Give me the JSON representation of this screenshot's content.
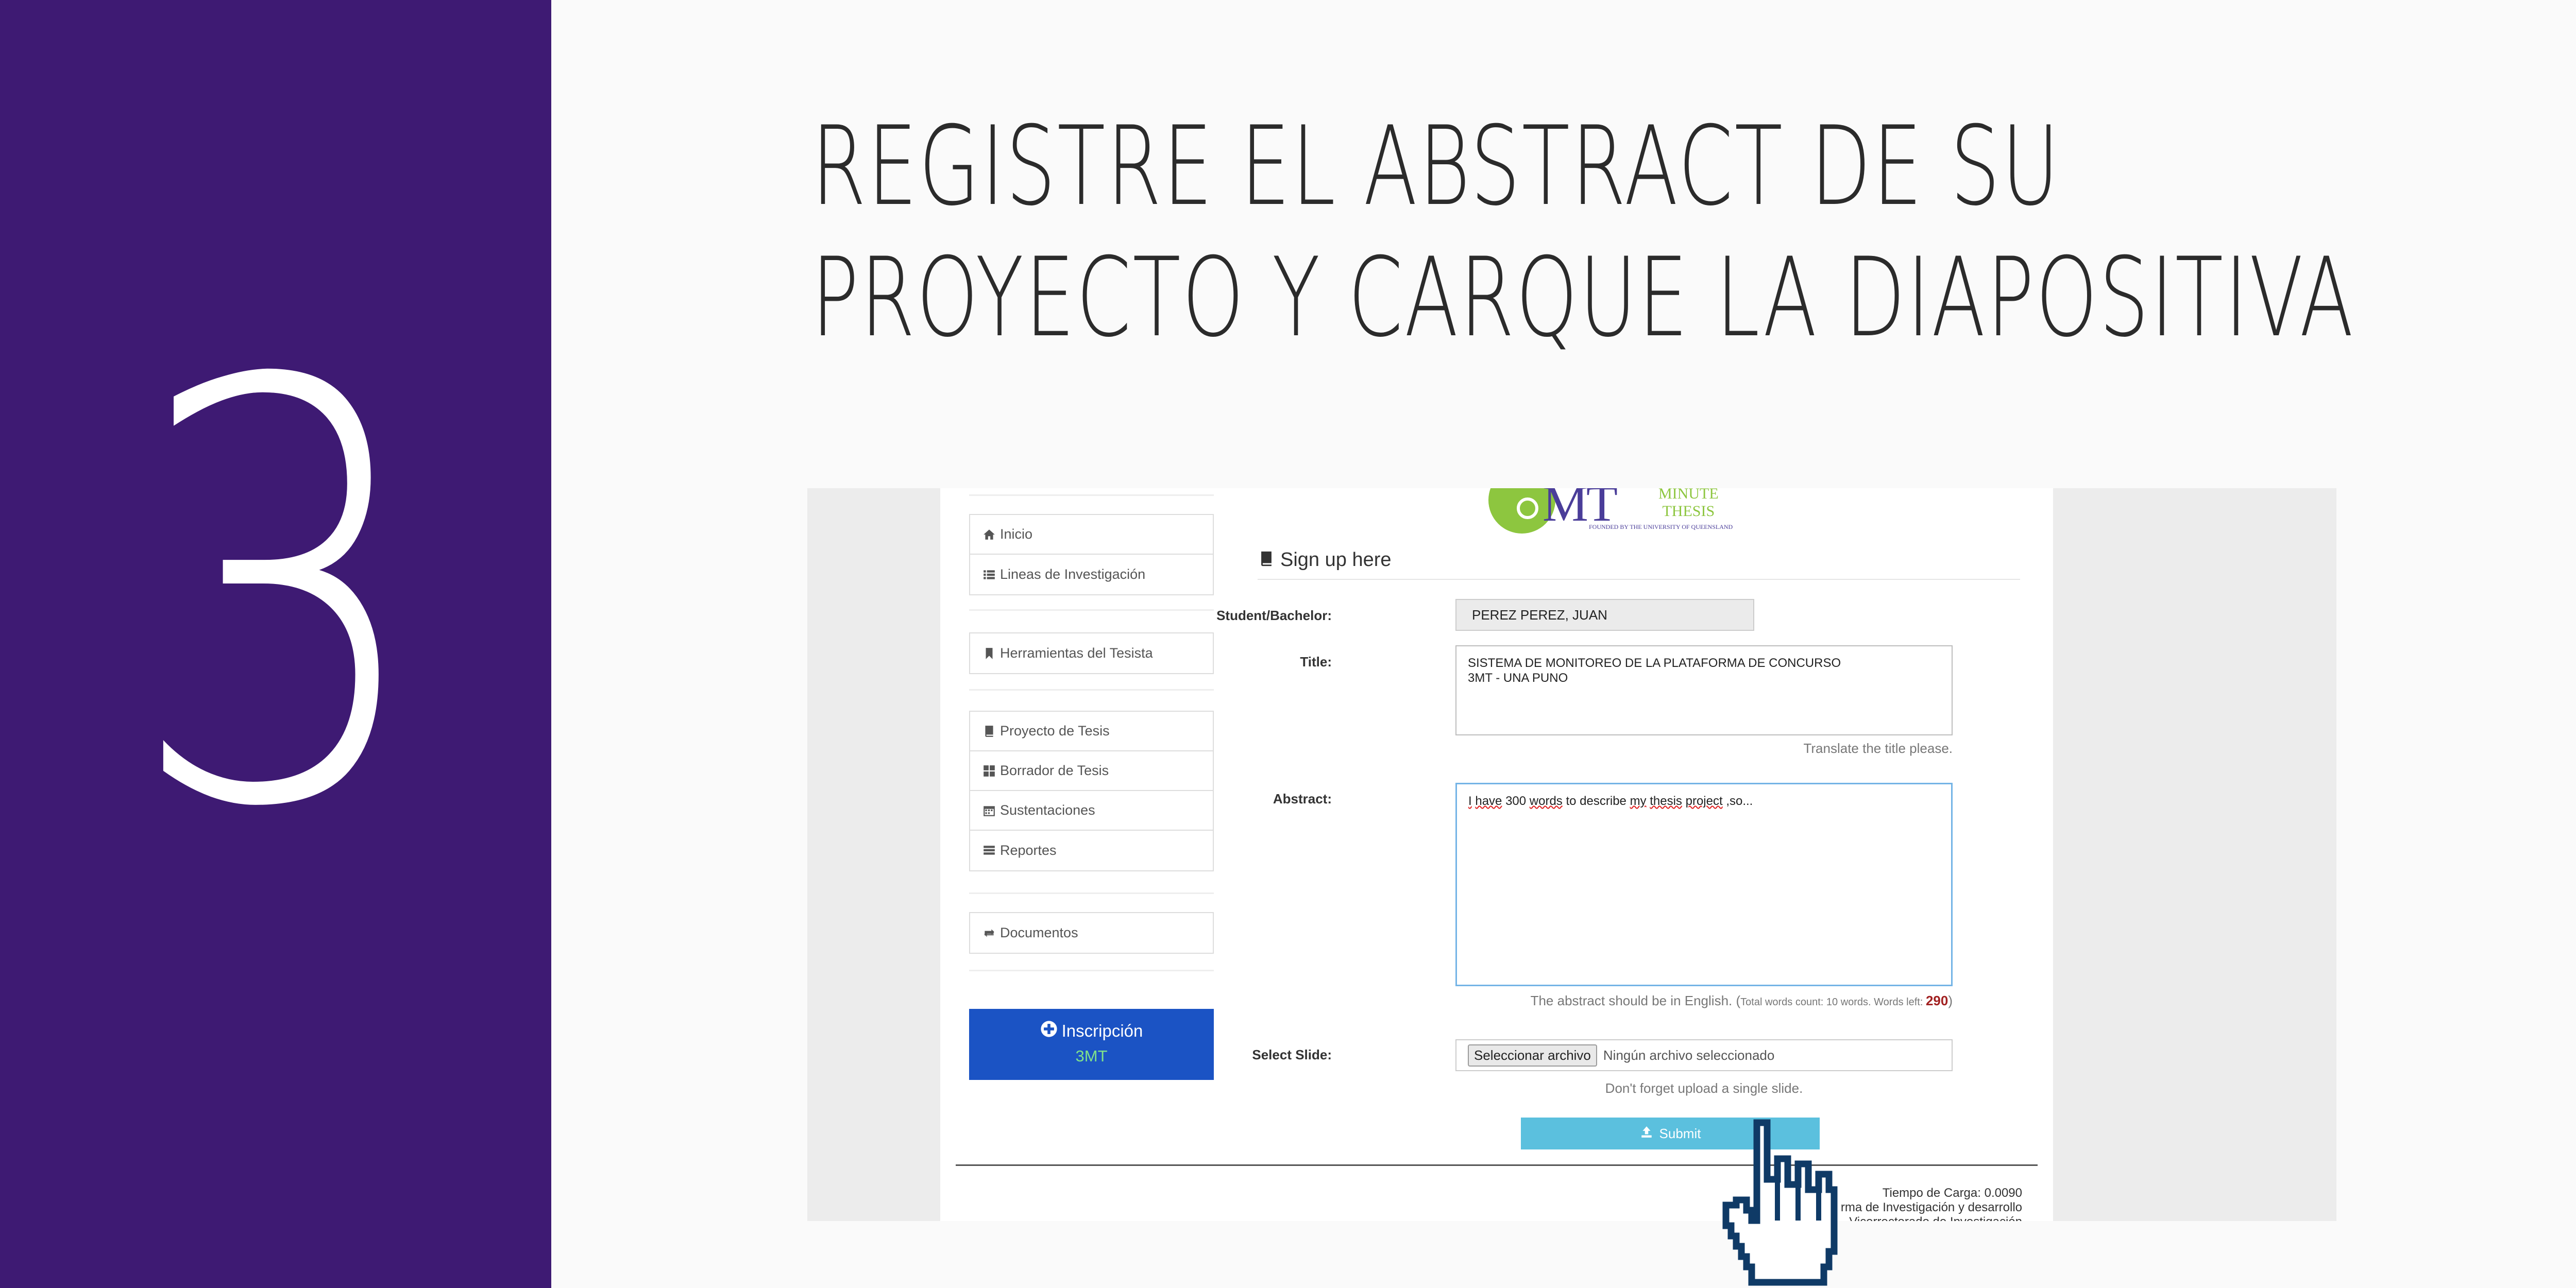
{
  "slide": {
    "step_number": "3",
    "title_line1": "REGISTRE EL ABSTRACT DE SU",
    "title_line2": "PROYECTO Y CARQUE LA DIAPOSITIVA",
    "band_color": "#3e1a73"
  },
  "logo": {
    "mt": "MT",
    "minute": "MINUTE",
    "thesis": "THESIS",
    "founded": "FOUNDED BY THE UNIVERSITY OF QUEENSLAND"
  },
  "sidebar": {
    "group1": [
      {
        "icon": "home-icon",
        "label": "Inicio"
      },
      {
        "icon": "list-icon",
        "label": "Lineas de Investigación"
      }
    ],
    "group2": [
      {
        "icon": "bookmark-icon",
        "label": "Herramientas del Tesista"
      }
    ],
    "group3": [
      {
        "icon": "book-icon",
        "label": "Proyecto de Tesis"
      },
      {
        "icon": "grid-icon",
        "label": "Borrador de Tesis"
      },
      {
        "icon": "calendar-icon",
        "label": "Sustentaciones"
      },
      {
        "icon": "list-icon",
        "label": "Reportes"
      }
    ],
    "group4": [
      {
        "icon": "retweet-icon",
        "label": "Documentos"
      }
    ],
    "inscripcion": {
      "icon": "plus-circle-icon",
      "line1": "Inscripción",
      "line2": "3MT"
    }
  },
  "form": {
    "heading": "Sign up here",
    "student_label": "Student/Bachelor:",
    "student_value": "PEREZ PEREZ, JUAN",
    "title_label": "Title:",
    "title_line1": "SISTEMA DE MONITOREO DE LA PLATAFORMA DE CONCURSO",
    "title_line2": "3MT - UNA PUNO",
    "title_hint": "Translate the title please.",
    "abstract_label": "Abstract:",
    "abstract_words": [
      "I",
      "have",
      "300",
      "words",
      "to",
      "describe",
      "my",
      "thesis",
      "project",
      ",so..."
    ],
    "abstract_hint_main": "The abstract should be in English. (",
    "abstract_hint_small": "Total words count: 10 words. Words left: ",
    "words_left": "290",
    "abstract_hint_close": ")",
    "slide_label": "Select Slide:",
    "file_button": "Seleccionar archivo",
    "file_status": "Ningún archivo seleccionado",
    "slide_hint": "Don't forget upload a single slide.",
    "submit_label": "Submit"
  },
  "footer": {
    "line1": "Tiempo de Carga: 0.0090",
    "line2": "rma de Investigación y desarrollo",
    "line3": "Vicerrectorado de Investigación"
  }
}
